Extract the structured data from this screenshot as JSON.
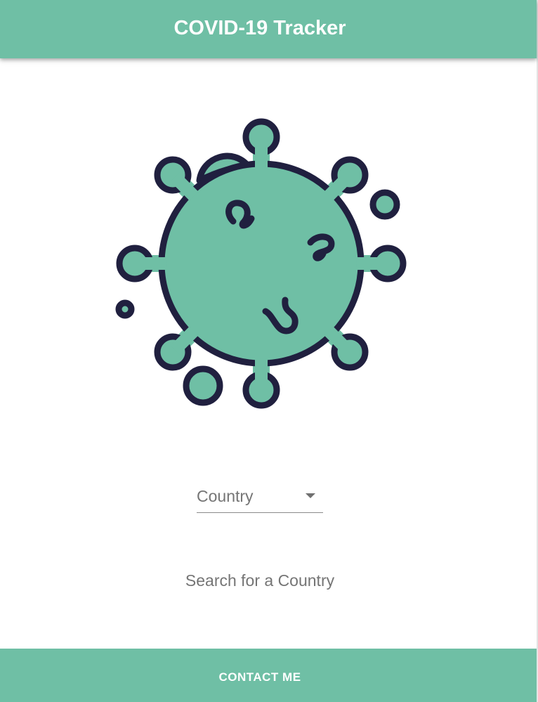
{
  "app": {
    "title": "COVID-19 Tracker"
  },
  "illustration": {
    "icon": "virus-icon",
    "fill_color": "#6fbfa5",
    "stroke_color": "#20203f"
  },
  "country_select": {
    "placeholder": "Country",
    "icon": "chevron-down-icon"
  },
  "main": {
    "hint": "Search for a Country"
  },
  "footer": {
    "contact_label": "CONTACT ME"
  },
  "colors": {
    "primary": "#6fbfa5",
    "text_on_primary": "#ffffff",
    "muted_text": "#757575"
  }
}
